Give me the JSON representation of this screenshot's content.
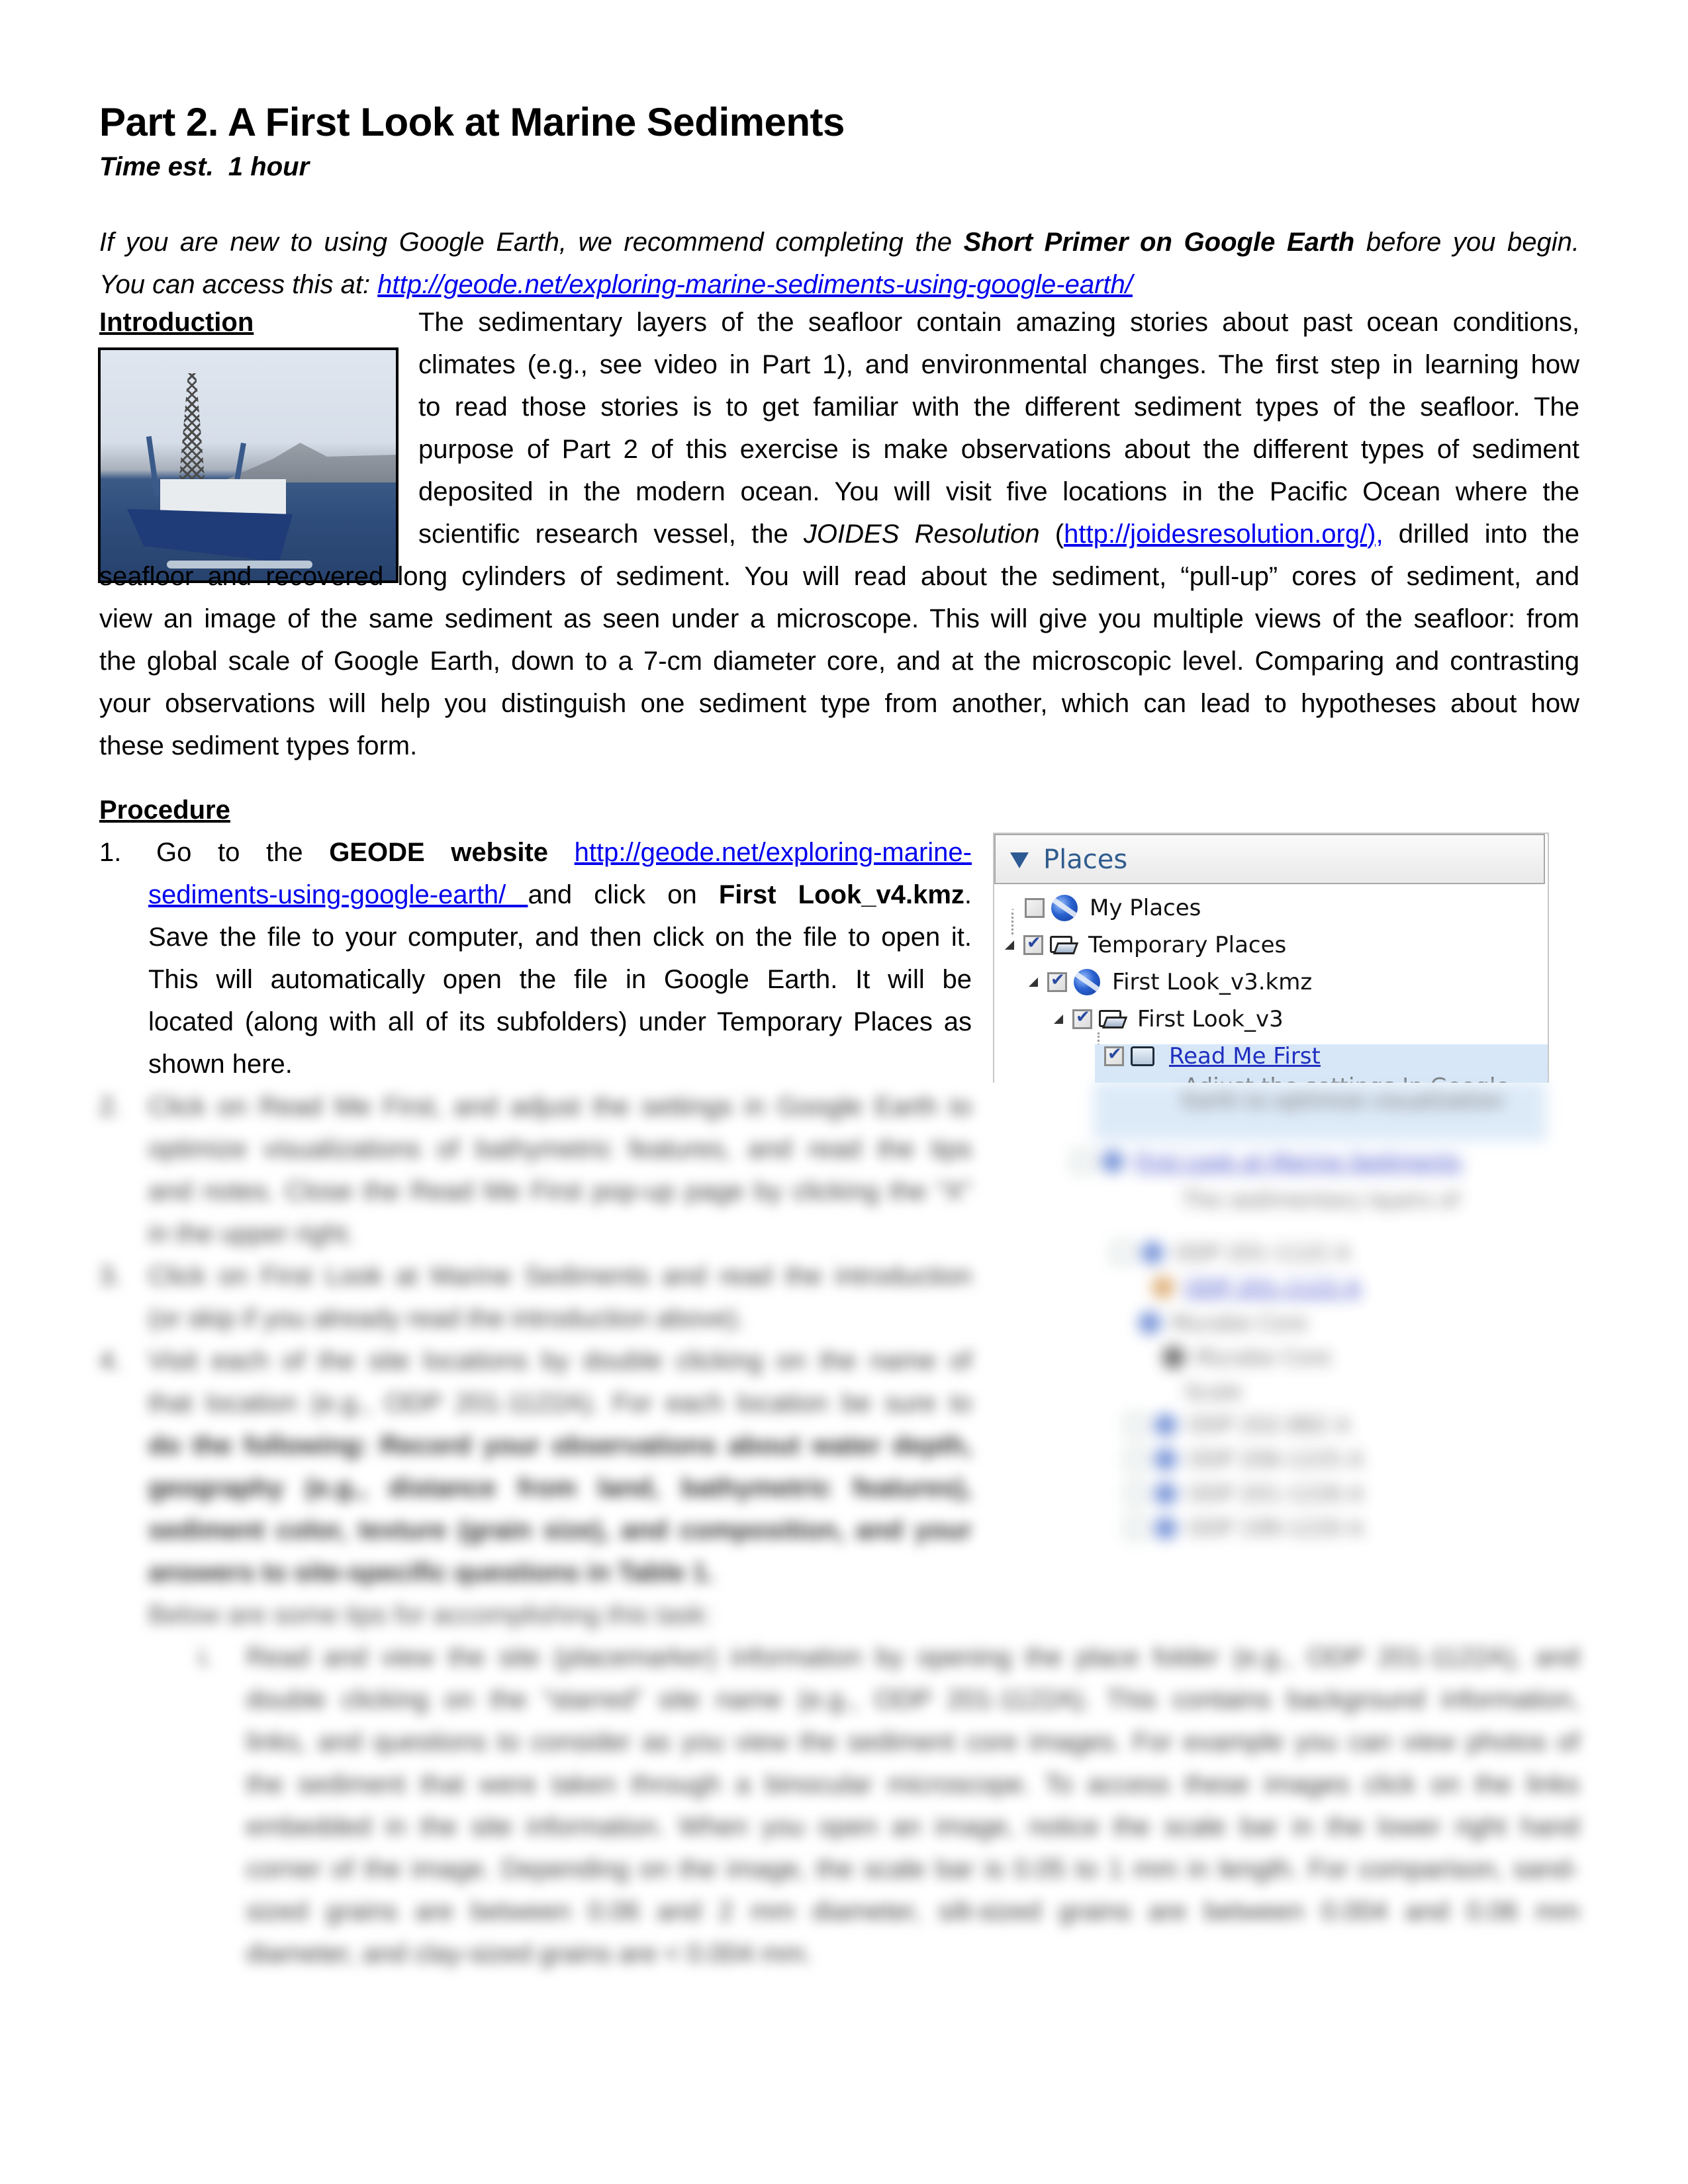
{
  "header": {
    "title": "Part 2. A First Look at Marine Sediments",
    "time_estimate": "Time est.  1 hour"
  },
  "primer_note": {
    "line1_pre": "If you are new to using Google Earth, we recommend completing the ",
    "line1_bold": "Short Primer on Google Earth",
    "line1_post": " before you begin.",
    "line2_pre": "You can access this at: ",
    "line2_link": "http://geode.net/exploring-marine-sediments-using-google-earth/"
  },
  "introduction": {
    "heading": "Introduction",
    "image_alt": "JOIDES Resolution drilling vessel at sea",
    "lines": [
      "The sedimentary layers of the seafloor contain amazing stories about past ocean conditions,",
      "climates (e.g., see video in Part 1), and environmental changes. The first step in learning how",
      "to read those stories is to get familiar with the different sediment types of the seafloor. The",
      "purpose of Part 2 of this exercise is make observations about the different types of sediment",
      "deposited in the modern ocean. You will visit five locations in the Pacific Ocean where the"
    ],
    "line6_pre": "scientific research vessel, the ",
    "line6_italic": "JOIDES Resolution",
    "line6_open": " (",
    "line6_link": "http://joidesresolution.org/",
    "line6_close": "),",
    "line6_post": " drilled into the",
    "full_lines": [
      "seafloor and recovered long cylinders of sediment. You will read about the sediment, “pull-up” cores of sediment, and",
      "view an image of the same sediment as seen under a microscope. This will give you multiple views of the seafloor: from",
      "the global scale of Google Earth, down to a 7-cm diameter core, and at the microscopic level. Comparing and contrasting",
      "your observations will help you distinguish one sediment type from another, which can lead to hypotheses about how"
    ],
    "last_line": "these sediment types form."
  },
  "procedure": {
    "heading": "Procedure",
    "step1": {
      "number": "1.",
      "l1_pre": "Go to the ",
      "l1_bold": "GEODE website",
      "l1_link": "http://geode.net/exploring-marine-",
      "l2_link": "sediments-using-google-earth/ ",
      "l2_mid": "and click on ",
      "l2_bold": "First Look_v4.kmz",
      "l2_end": ".",
      "l3": "Save the file to your computer, and then click on the file to open it.",
      "l4": "This will automatically open the file in Google Earth. It will be",
      "l5": "located (along with all of its subfolders) under Temporary Places as",
      "l6": "shown here."
    },
    "blurred_steps": [
      {
        "number": "2.",
        "lines": [
          "Click on Read Me First, and adjust the settings in Google Earth to",
          "optimize visualizations of bathymetric features, and read the tips",
          "and notes. Close the Read Me First pop-up page by clicking the “X”",
          "in the upper right."
        ]
      },
      {
        "number": "3.",
        "lines": [
          "Click on First Look at Marine Sediments and read the introduction",
          "(or skip if you already read the introduction above)."
        ]
      },
      {
        "number": "4.",
        "lines": [
          "Visit each of the site locations by double clicking on the name of",
          "that location (e.g., ODP 201-1122A). For each location be sure to",
          "do the following: Record your observations about water depth,",
          "geography (e.g., distance from land, bathymetric features),",
          "sediment color, texture (grain size), and composition, and your",
          "answers to site-specific questions in Table 1."
        ]
      }
    ],
    "tips_intro": "Below are some tips for accomplishing this task:",
    "substep": {
      "number": "i.",
      "lines": [
        "Read and view the site (placemarker) information by opening the place folder (e.g., ODP 201-1122A), and",
        "double clicking on the “starred” site name (e.g., ODP 201-1122A). This contains background information,",
        "links, and questions to consider as you view the sediment core images. For example you can view photos of",
        "the sediment that were taken through a binocular microscope. To access these images click on the links",
        "embedded in the site information. When you open an image, notice the scale bar in the lower right hand",
        "corner of the image. Depending on the image, the scale bar is 0.05 to 1 mm in length. For comparison, sand-",
        "sized grains are between 0.06 and 2 mm diameter, silt-sized grains are between 0.004 and 0.06 mm",
        "diameter, and clay-sized grains are < 0.004 mm."
      ]
    }
  },
  "places_panel": {
    "header": "Places",
    "items": [
      {
        "label": "My Places",
        "checked": false,
        "icon": "google-earth-globe-icon",
        "expanded": false
      },
      {
        "label": "Temporary Places",
        "checked": true,
        "icon": "open-folder-icon",
        "expanded": true
      },
      {
        "label": "First Look_v3.kmz",
        "checked": true,
        "icon": "google-earth-globe-icon",
        "expanded": true
      },
      {
        "label": "First Look_v3",
        "checked": true,
        "icon": "open-folder-icon",
        "expanded": true
      },
      {
        "label": "Read Me First",
        "checked": true,
        "icon": "folder-icon",
        "selected": true,
        "link": true
      }
    ],
    "read_me_desc": "Adjust the settings In Google",
    "blurred_items": [
      "Earth to optimize visualization",
      "First Look at Marine Sediments",
      "The sedimentary layers of",
      "ODP 201-1122 A",
      "ODP 201-1122 A",
      "Murabe Core",
      "Murabe Core",
      "Scale",
      "ODP 202-882 A",
      "ODP 206-1225 A",
      "ODP 201-1226 A",
      "ODP 199-1220 A"
    ]
  },
  "colors": {
    "link": "#0000ee",
    "places_header_text": "#305c8f",
    "selection": "#d7e7f7"
  }
}
